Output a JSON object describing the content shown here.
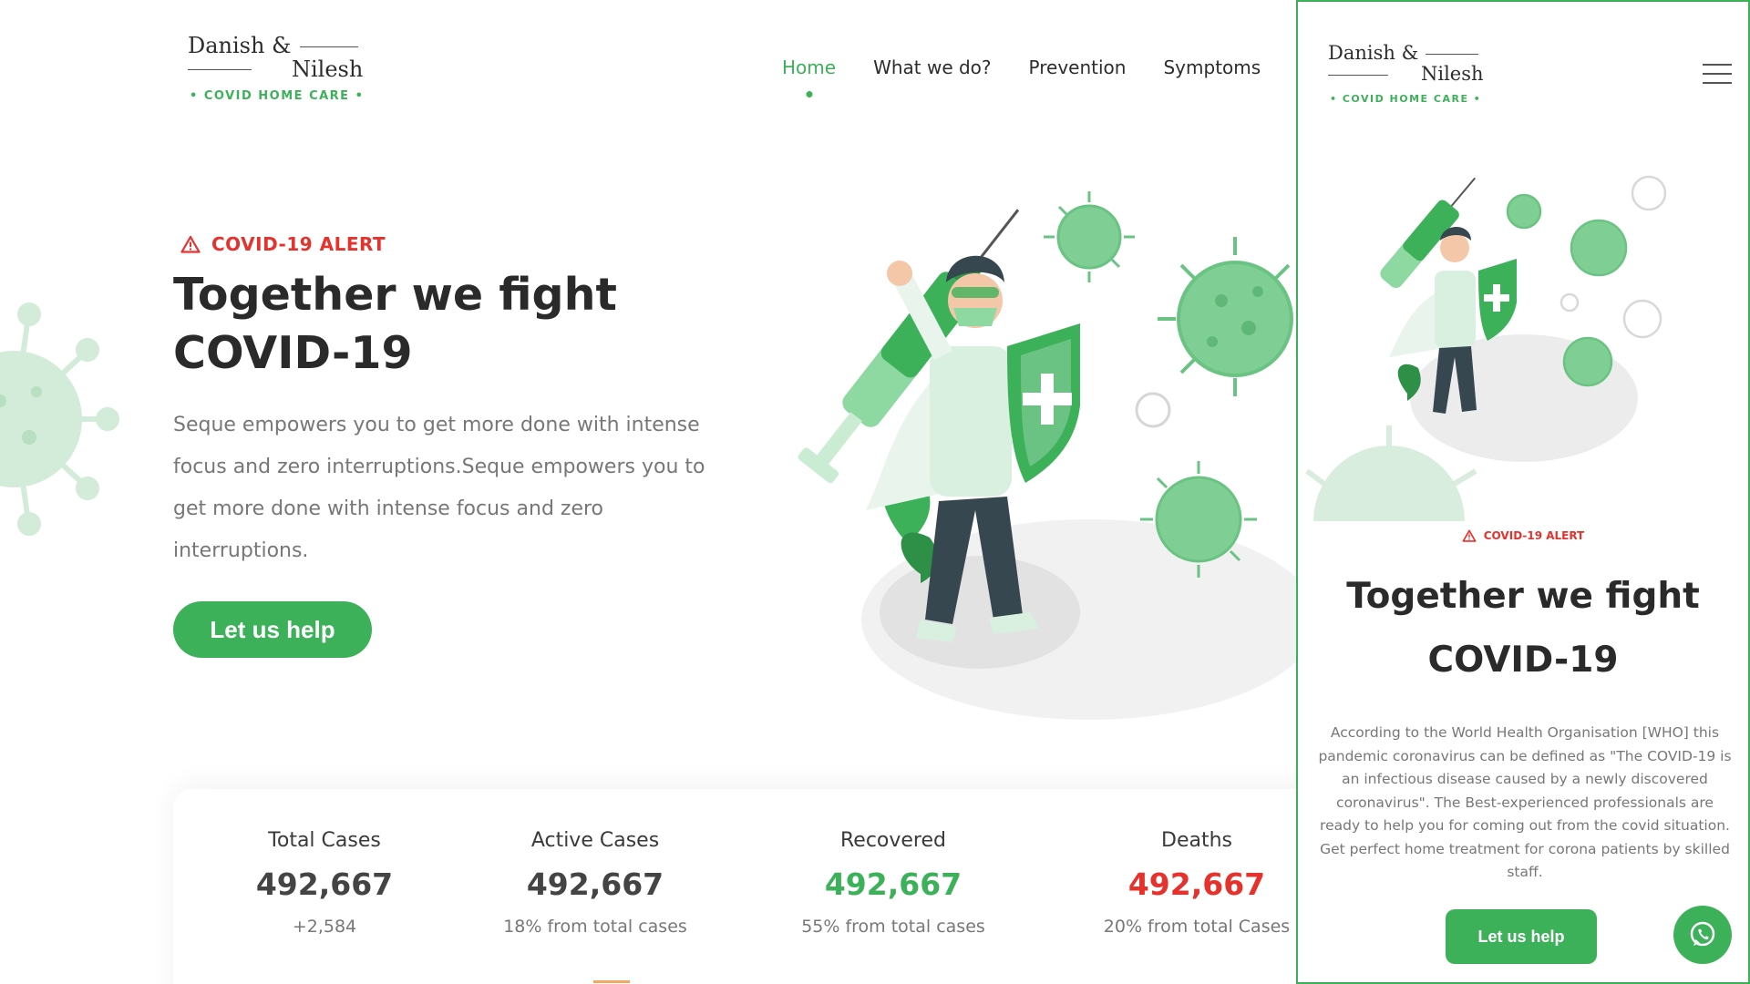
{
  "brand": {
    "line1": "Danish &",
    "line2": "Nilesh",
    "tagline": "•  COVID HOME CARE  •"
  },
  "nav": {
    "items": [
      {
        "label": "Home",
        "active": true
      },
      {
        "label": "What we do?",
        "active": false
      },
      {
        "label": "Prevention",
        "active": false
      },
      {
        "label": "Symptoms",
        "active": false
      }
    ]
  },
  "hero": {
    "alert": "COVID-19 ALERT",
    "title_line1": "Together we fight",
    "title_line2": "COVID-19",
    "description": "Seque empowers you to get more done with intense focus and zero interruptions.Seque empowers you to get more done with intense focus and zero interruptions.",
    "cta": "Let us help"
  },
  "stats": [
    {
      "label": "Total Cases",
      "value": "492,667",
      "sub": "+2,584",
      "tone": "neutral"
    },
    {
      "label": "Active Cases",
      "value": "492,667",
      "sub": "18% from total cases",
      "tone": "neutral"
    },
    {
      "label": "Recovered",
      "value": "492,667",
      "sub": "55% from total cases",
      "tone": "green"
    },
    {
      "label": "Deaths",
      "value": "492,667",
      "sub": "20% from total Cases",
      "tone": "red"
    }
  ],
  "mobile": {
    "alert": "COVID-19 ALERT",
    "title_line1": "Together we fight",
    "title_line2": "COVID-19",
    "description": "According to the World Health Organisation [WHO] this pandemic coronavirus can be defined as \"The COVID-19 is an infectious disease caused by a newly discovered coronavirus\". The Best-experienced professionals are ready to help you for coming out from the covid situation. Get perfect home treatment for corona patients by skilled staff.",
    "cta": "Let us help"
  },
  "icons": {
    "alert": "warning-triangle-icon",
    "menu": "hamburger-menu-icon",
    "chat": "whatsapp-icon"
  },
  "colors": {
    "accent": "#3db15a",
    "alert": "#e5322d",
    "text": "#2a2a2a",
    "muted": "#777777"
  }
}
